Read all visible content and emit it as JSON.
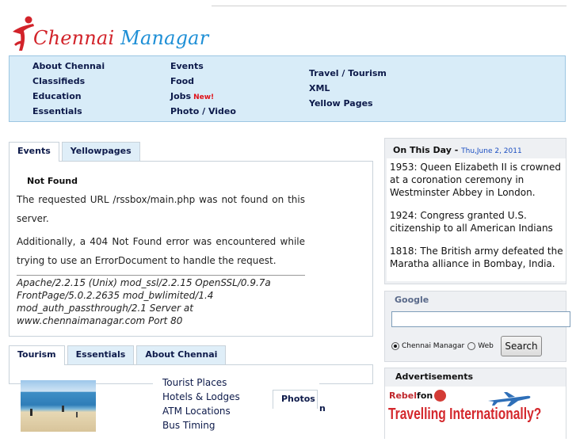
{
  "logo": {
    "part1": "Chennai",
    "part2": "Managar"
  },
  "nav": {
    "col1": [
      "About Chennai",
      "Classifieds",
      "Education",
      "Essentials"
    ],
    "col2": [
      "Events",
      "Food",
      "Jobs",
      "Photo / Video"
    ],
    "col2_badge": "New!",
    "col3": [
      "Travel / Tourism",
      "XML",
      "Yellow Pages"
    ]
  },
  "events_tabs": [
    "Events",
    "Yellowpages"
  ],
  "error": {
    "title": "Not Found",
    "p1": "The requested URL /rssbox/main.php was not found on this server.",
    "p2": "Additionally, a 404 Not Found error was encountered while trying to use an ErrorDocument to handle the request.",
    "address": "Apache/2.2.15 (Unix) mod_ssl/2.2.15 OpenSSL/0.9.7a FrontPage/5.0.2.2635 mod_bwlimited/1.4 mod_auth_passthrough/2.1 Server at www.chennaimanagar.com Port 80"
  },
  "tourism_tabs": [
    "Tourism",
    "Essentials",
    "About Chennai"
  ],
  "tourism_menu": [
    "Tourist Places",
    "Hotels & Lodges",
    "ATM Locations",
    "Bus Timing"
  ],
  "photos_tab": "Photos",
  "overflow_text": "n",
  "on_this_day": {
    "title": "On This Day",
    "sep": " - ",
    "date": "Thu,June 2, 2011",
    "entries": [
      "1953:  Queen Elizabeth II is crowned at a coronation ceremony in Westminster Abbey in London.",
      "1924:  Congress granted U.S. citizenship to all American Indians",
      "1818:  The British army defeated the Maratha alliance in Bombay, India."
    ]
  },
  "google_search": {
    "logo": "Google",
    "input_value": "",
    "radio_site": "Chennai Managar",
    "radio_web": "Web",
    "button": "Search"
  },
  "ads": {
    "title": "Advertisements",
    "brand1": "Rebel",
    "brand2": "fon",
    "headline": "Travelling Internationally?"
  }
}
